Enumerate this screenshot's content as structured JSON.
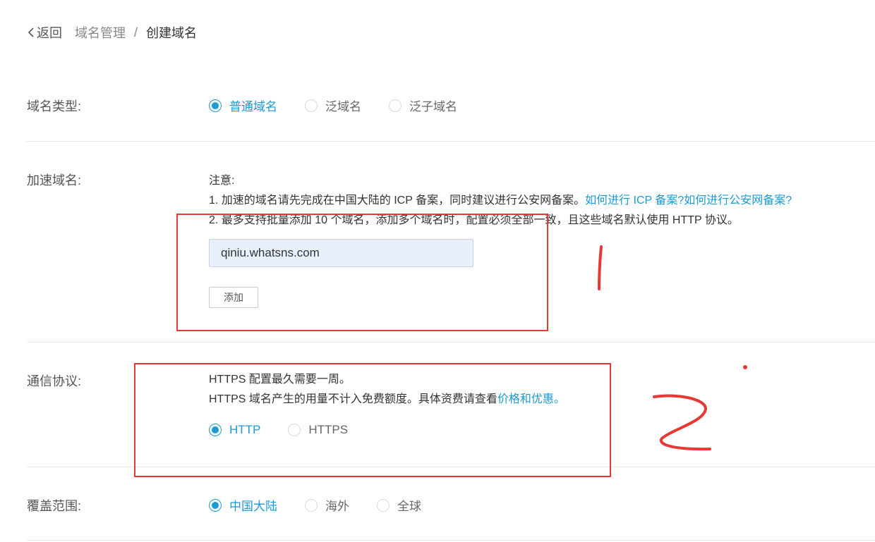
{
  "breadcrumb": {
    "back": "返回",
    "parent": "域名管理",
    "separator": "/",
    "current": "创建域名"
  },
  "domain_type": {
    "label": "域名类型:",
    "options": [
      "普通域名",
      "泛域名",
      "泛子域名"
    ],
    "selected": "普通域名"
  },
  "accel_domain": {
    "label": "加速域名:",
    "note_title": "注意:",
    "note1_text": "1. 加速的域名请先完成在中国大陆的 ICP 备案，同时建议进行公安网备案。",
    "note1_link1": "如何进行 ICP 备案?",
    "note1_link2": "如何进行公安网备案?",
    "note2_text": "2. 最多支持批量添加 10 个域名，添加多个域名时，配置必须全部一致，且这些域名默认使用 HTTP 协议。",
    "input_value": "qiniu.whatsns.com",
    "add_button": "添加"
  },
  "protocol": {
    "label": "通信协议:",
    "line1": "HTTPS 配置最久需要一周。",
    "line2_text": "HTTPS 域名产生的用量不计入免费额度。具体资费请查看",
    "line2_link": "价格和优惠。",
    "options": [
      "HTTP",
      "HTTPS"
    ],
    "selected": "HTTP"
  },
  "coverage": {
    "label": "覆盖范围:",
    "options": [
      "中国大陆",
      "海外",
      "全球"
    ],
    "selected": "中国大陆"
  },
  "annotations": {
    "color": "#e53935",
    "mark1": "1",
    "mark2": "2"
  },
  "colors": {
    "accent": "#1a9ad6",
    "input_bg": "#e8f0fe"
  }
}
